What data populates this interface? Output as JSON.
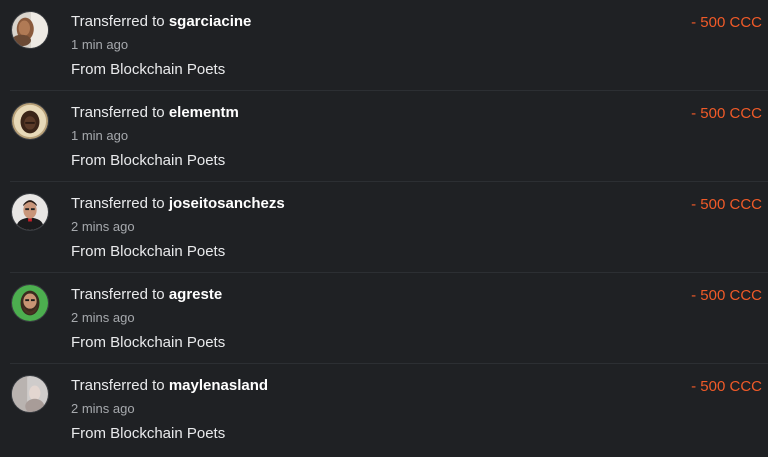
{
  "transfers": [
    {
      "title_prefix": "Transferred to ",
      "recipient": "sgarciacine",
      "time": "1 min ago",
      "memo": "From Blockchain Poets",
      "amount": "- 500 CCC",
      "avatar_icon": "profile-photo-icon"
    },
    {
      "title_prefix": "Transferred to ",
      "recipient": "elementm",
      "time": "1 min ago",
      "memo": "From Blockchain Poets",
      "amount": "- 500 CCC",
      "avatar_icon": "profile-photo-icon"
    },
    {
      "title_prefix": "Transferred to ",
      "recipient": "joseitosanchezs",
      "time": "2 mins ago",
      "memo": "From Blockchain Poets",
      "amount": "- 500 CCC",
      "avatar_icon": "profile-photo-icon"
    },
    {
      "title_prefix": "Transferred to ",
      "recipient": "agreste",
      "time": "2 mins ago",
      "memo": "From Blockchain Poets",
      "amount": "- 500 CCC",
      "avatar_icon": "profile-photo-icon"
    },
    {
      "title_prefix": "Transferred to ",
      "recipient": "maylenasland",
      "time": "2 mins ago",
      "memo": "From Blockchain Poets",
      "amount": "- 500 CCC",
      "avatar_icon": "profile-photo-icon"
    }
  ],
  "colors": {
    "background": "#1f2124",
    "amount": "#f05a28",
    "primary_text": "#e9eaec",
    "secondary_text": "#a6a9ad"
  }
}
